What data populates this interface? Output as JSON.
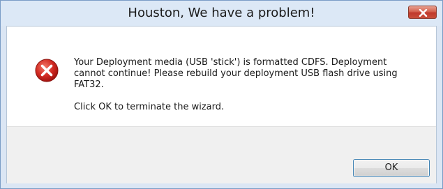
{
  "window": {
    "title": "Houston, We have a problem!"
  },
  "message": {
    "text": "Your Deployment media (USB 'stick') is formatted CDFS. Deployment cannot continue! Please rebuild your deployment USB flash drive using FAT32.",
    "instruction": "Click OK to terminate the wizard."
  },
  "buttons": {
    "ok_label": "OK"
  },
  "icons": {
    "title_close": "close-icon",
    "message": "error-icon"
  },
  "colors": {
    "close_button": "#c84f3a",
    "error_icon": "#c8201e",
    "ok_border": "#3c7fb1"
  }
}
